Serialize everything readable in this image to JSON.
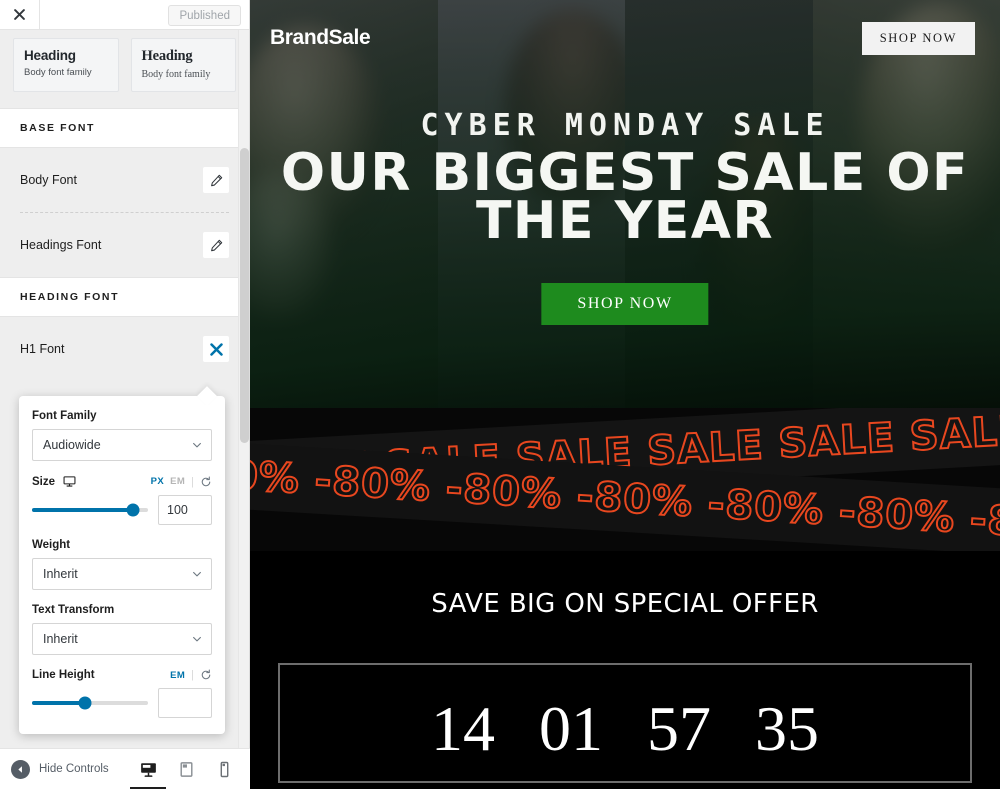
{
  "sidebar": {
    "topbar": {
      "close_label": "Close",
      "publish_status": "Published"
    },
    "font_cards": [
      {
        "heading": "Heading",
        "body": "Body font family"
      },
      {
        "heading": "Heading",
        "body": "Body font family"
      }
    ],
    "sections": [
      {
        "title": "BASE FONT",
        "rows": [
          {
            "label": "Body Font",
            "action": "edit"
          },
          {
            "label": "Headings Font",
            "action": "edit"
          }
        ]
      },
      {
        "title": "HEADING FONT",
        "rows": [
          {
            "label": "H1 Font",
            "action": "close"
          }
        ]
      }
    ],
    "bottom": {
      "hide_controls": "Hide Controls",
      "devices": [
        {
          "name": "desktop",
          "active": true
        },
        {
          "name": "tablet",
          "active": false
        },
        {
          "name": "mobile",
          "active": false
        }
      ]
    }
  },
  "popover": {
    "font_family": {
      "label": "Font Family",
      "value": "Audiowide"
    },
    "size": {
      "label": "Size",
      "units": [
        "PX",
        "EM"
      ],
      "active_unit": "PX",
      "value": "100",
      "slider_percent": 87
    },
    "weight": {
      "label": "Weight",
      "value": "Inherit"
    },
    "text_transform": {
      "label": "Text Transform",
      "value": "Inherit"
    },
    "line_height": {
      "label": "Line Height",
      "units": [
        "EM"
      ],
      "active_unit": "EM",
      "value": "",
      "placeholder": "",
      "slider_percent": 46
    }
  },
  "preview": {
    "brand": "BrandSale",
    "nav_cta": "SHOP NOW",
    "hero": {
      "eyebrow": "CYBER  MONDAY  SALE",
      "headline_line1": "OUR BIGGEST SALE OF",
      "headline_line2": "THE YEAR",
      "cta": "SHOP NOW"
    },
    "band": {
      "ribbon_top": "LE  SALE  SALE  SALE  SALE  SALE  SALE",
      "ribbon_bottom": "-80%  -80%  -80%  -80%  -80%  -80%  -80%"
    },
    "offer": {
      "title": "SAVE BIG ON SPECIAL OFFER",
      "countdown": [
        "14",
        "01",
        "57",
        "35"
      ]
    }
  },
  "colors": {
    "accent_blue": "#0073aa",
    "cta_green": "#1e8b1e",
    "sale_orange": "#e8471f",
    "sidebar_bg": "#eeeeee"
  }
}
